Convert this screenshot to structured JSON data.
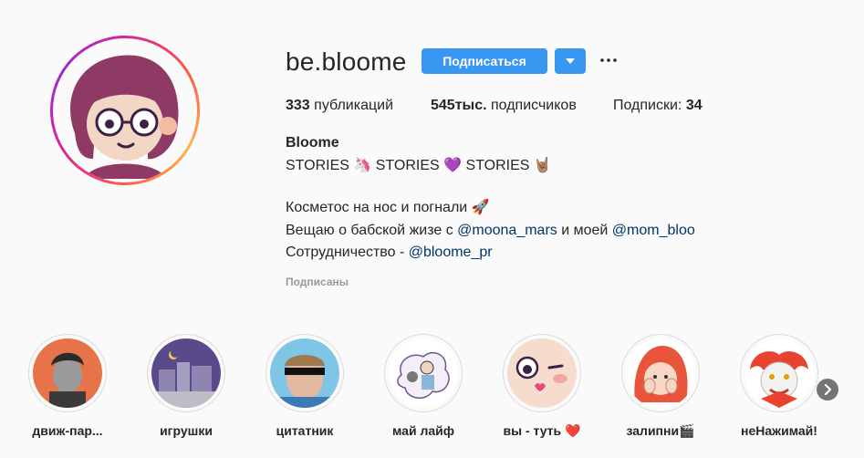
{
  "profile": {
    "username": "be.bloome",
    "follow_label": "Подписаться",
    "stats": {
      "posts_count": "333",
      "posts_label": "публикаций",
      "followers_count": "545тыс.",
      "followers_label": "подписчиков",
      "following_label": "Подписки:",
      "following_count": "34"
    },
    "bio": {
      "name": "Bloome",
      "line1": "STORIES 🦄 STORIES 💜 STORIES 🤘🏽",
      "line2": "Косметос на нос и погнали 🚀",
      "line3_prefix": "Вещаю о бабской жизе с ",
      "line3_mention1": "@moona_mars",
      "line3_middle": " и моей ",
      "line3_mention2": "@mom_bloo",
      "line4_prefix": "Сотрудничество - ",
      "line4_mention": "@bloome_pr",
      "followed_by": "Подписаны"
    }
  },
  "highlights": [
    {
      "label": "движ-пар..."
    },
    {
      "label": "игрушки"
    },
    {
      "label": "цитатник"
    },
    {
      "label": "май лайф"
    },
    {
      "label": "вы - туть ❤️"
    },
    {
      "label": "залипни🎬"
    },
    {
      "label": "неНажимай!"
    }
  ],
  "icons": {
    "dropdown": "chevron-down-icon",
    "more": "more-horizontal-icon",
    "next": "chevron-right-icon"
  },
  "colors": {
    "accent": "#3897f0",
    "mention": "#003569",
    "muted": "#999999"
  }
}
